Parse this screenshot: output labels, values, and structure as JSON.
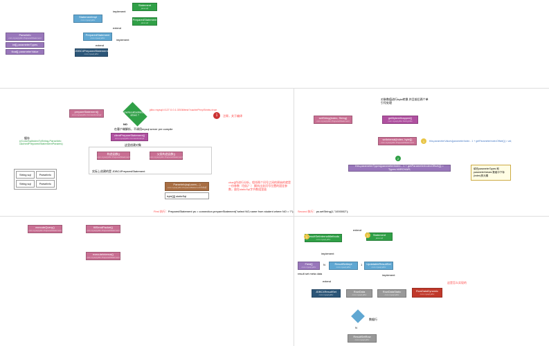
{
  "top": {
    "statement": {
      "title": "Statement",
      "sub": "java.sql"
    },
    "prepared": {
      "title": "PreparedStatement",
      "sub": "java.sql"
    },
    "statImpl": {
      "title": "StatementImpl",
      "sub": "com.mysql.jdbc"
    },
    "prepStmt": {
      "title": "PreparedStatement",
      "sub": "com.mysql.jdbc"
    },
    "jdbc4": {
      "title": "JDBC4PreparedStatement",
      "sub": "com.mysql.jdbc"
    },
    "parseInfo": {
      "title": "ParseInfo",
      "sub": "com.mysql.jdbc.PreparedStatement"
    },
    "f1": "int[] parameterTypes",
    "f2": "float[] parameterValue",
    "r1": "implement",
    "r2": "extend",
    "r3": "extend",
    "r4": "implement"
  },
  "mid_left": {
    "storage": "缓存",
    "storage_detail": "((ConcSqlIndexToString,ParseInfo\ncachedPreparedStatementParams)",
    "prepareStmt": {
      "title": "prepareStatement()",
      "sub": "com.mysql.jdbc.ConnectionImpl"
    },
    "diamond": "cacheResultSetMetadata\nallows ?",
    "jdbcUrl": "jdbc:mysql://127.0.0.1:3306/test?cachePrepStmts=true",
    "no": "NO",
    "note1": "在客户端解析，不调用mysql server pre compile",
    "clientPrep": {
      "title": "clientPrepareStatement()",
      "sub": "com.mysql.jdbc.ConnectionImpl"
    },
    "note2": "这里创建对象",
    "bigbox_note": "实际上创建的是 JDBC4PreparedStatement",
    "construct1": {
      "title": "构造函数()",
      "sub": "com.mysql.jdbc.PreparedStatement"
    },
    "construct2": {
      "title": "父类构造函数()",
      "sub": "com.mysql.jdbc.PreparedStatement"
    },
    "parseInfo": {
      "title": "ParseInfo(sql,conn,...)",
      "sub": "com.mysql.jdbc.PreparedStatement的构造"
    },
    "byte_field": "byte[][] staticSql",
    "side_note": "char[]作进行分析，相邻两个问号之间的原始的就是一份参数（包括？）\n解析出非问号位置的固定参数，放在staticSql字节数组里面",
    "red_label": "注释，关于编译",
    "tbl": {
      "r1c1": "String sql",
      "r1c2": "ParseInfo",
      "r2c1": "String sql",
      "r2c2": "ParseInfo"
    }
  },
  "mid_right": {
    "top_note": "对参数值进行byte转换\n并且前后两个单引号处理",
    "setString": {
      "title": "setString(index, String)",
      "sub": "com.mysql.jdbc.PreparedStatement"
    },
    "getBytes": {
      "title": "getBytesWrapped()",
      "sub": "com.mysql.jdbc.StringUtils"
    },
    "setInternal": {
      "title": "setInternal(index, byte[])",
      "sub": "com.mysql.jdbc.PreparedStatement"
    },
    "expr1": "this.parameterValues[parameterIndex - 1 + getParameterIndexOffset()] = val;",
    "expr2": "this.parameterTypes[parameterIndex - 1 + getParameterIndexOffset()] = Types.VARCHAR;",
    "note": "填充parameterTypes\n和parameterValues\n数组中下标(index)的元素"
  },
  "captions": {
    "first": "First 执行：PreparedStatement ps = connection.prepareStatement(\"select NO,name from student where NO = ?\");",
    "second": "Second 执行：ps.setString(1,\"1000002\");"
  },
  "bot_left": {
    "execQuery": {
      "title": "executeQuery()",
      "sub": "com.mysql.jdbc.PreparedStatement"
    },
    "fillPacket": {
      "title": "fillSendPacket()",
      "sub": "com.mysql.jdbc.PreparedStatement"
    },
    "execInternal": {
      "title": "executeInternal()",
      "sub": "com.mysql.jdbc.PreparedStatement"
    }
  },
  "bot_right": {
    "statement": {
      "title": "Statement",
      "sub": "java.sql"
    },
    "resultSetMethods": {
      "title": "ResultSetInternalMethods",
      "sub": "com.mysql.jdbc"
    },
    "resultSetImpl": {
      "title": "ResultSetImpl",
      "sub": "com.mysql.jdbc"
    },
    "updResultSet": {
      "title": "UpdatableResultSet",
      "sub": "com.mysql.jdbc"
    },
    "jdbc4rs": {
      "title": "JDBC4ResultSet",
      "sub": "com.mysql.jdbc"
    },
    "rowData": {
      "title": "RowData",
      "sub": "com.mysql.jdbc"
    },
    "rowDataStatic": {
      "title": "RowDataStatic",
      "sub": "com.mysql.jdbc"
    },
    "rowDataDynamic": {
      "title": "RowDataDynamic",
      "sub": "com.mysql.jdbc"
    },
    "resultSetRow": {
      "title": "ResultSetRow",
      "sub": "com.mysql.jdbc"
    },
    "field": {
      "title": "Field[]",
      "sub": "com.mysql.jdbc"
    },
    "field_note": "result set meta data",
    "data_row": "数据行",
    "red_note": "这是怎么实现的",
    "r_extend": "extend",
    "r_implement": "implement",
    "n": "N",
    "n1": "1"
  }
}
